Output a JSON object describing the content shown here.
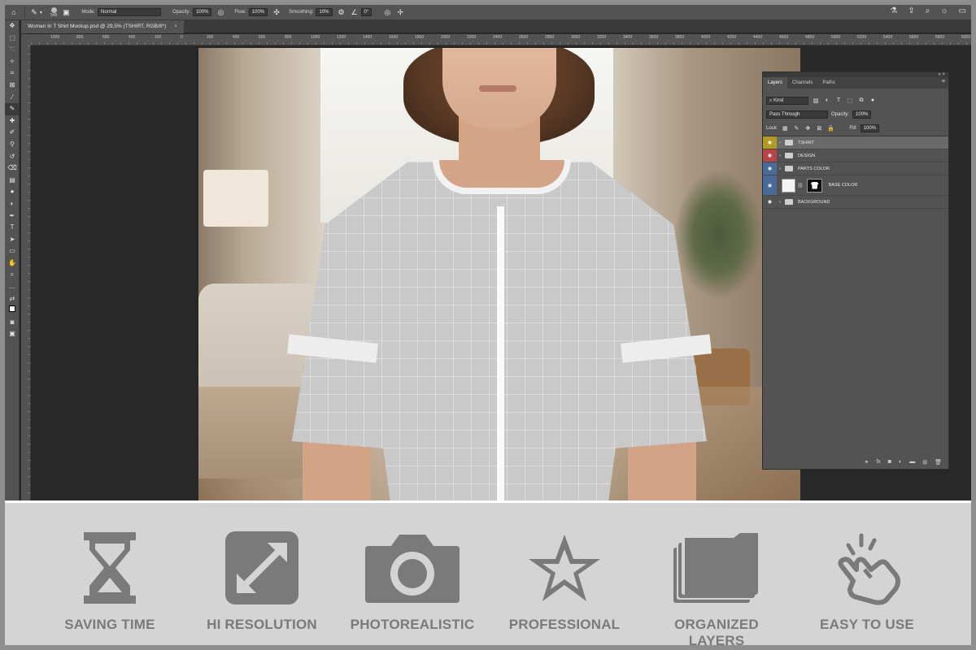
{
  "options_bar": {
    "brush_size": "545",
    "mode_label": "Mode:",
    "mode_value": "Normal",
    "opacity_label": "Opacity:",
    "opacity_value": "100%",
    "flow_label": "Flow:",
    "flow_value": "100%",
    "smoothing_label": "Smoothing:",
    "smoothing_value": "10%",
    "angle_value": "0°"
  },
  "document": {
    "tab_title": "Woman In T Shirt Mockup.psd @ 29,5% (TSHIRT, RGB/8*)",
    "close_glyph": "×"
  },
  "ruler": {
    "ticks": [
      "1000",
      "800",
      "600",
      "400",
      "200",
      "0",
      "200",
      "400",
      "600",
      "800",
      "1000",
      "1200",
      "1400",
      "1600",
      "1800",
      "2000",
      "2200",
      "2400",
      "2600",
      "2800",
      "3000",
      "3200",
      "3400",
      "3600",
      "3800",
      "4000",
      "4200",
      "4400",
      "4600",
      "4800",
      "5000",
      "5200",
      "5400",
      "5600",
      "5800",
      "6000"
    ]
  },
  "layers_panel": {
    "tabs": [
      "Layers",
      "Channels",
      "Paths"
    ],
    "filter_value": "Kind",
    "blend_mode": "Pass Through",
    "opacity_label": "Opacity:",
    "opacity_value": "100%",
    "lock_label": "Lock:",
    "fill_label": "Fill:",
    "fill_value": "100%",
    "layers": [
      {
        "name": "TSHIRT",
        "color": "#b09a24",
        "type": "group",
        "selected": true
      },
      {
        "name": "DESIGN",
        "color": "#b6454a",
        "type": "group",
        "selected": false
      },
      {
        "name": "PARTS COLOR",
        "color": "#4a6a98",
        "type": "group",
        "selected": false
      },
      {
        "name": "BASE COLOR",
        "color": "#4a6a98",
        "type": "smart",
        "selected": false
      },
      {
        "name": "BACKGROUND",
        "color": "#535353",
        "type": "group",
        "selected": false
      }
    ]
  },
  "features": [
    {
      "label": "SAVING TIME",
      "icon": "hourglass-icon"
    },
    {
      "label": "HI RESOLUTION",
      "icon": "expand-arrows-icon"
    },
    {
      "label": "PHOTOREALISTIC",
      "icon": "camera-icon"
    },
    {
      "label": "PROFESSIONAL",
      "icon": "star-icon"
    },
    {
      "label": "ORGANIZED LAYERS",
      "icon": "layers-folder-icon"
    },
    {
      "label": "EASY TO USE",
      "icon": "tap-hand-icon"
    }
  ],
  "colors": {
    "feature_icon": "#7a7a7a",
    "feature_band": "#d4d4d4",
    "app_bg": "#282828",
    "panel_bg": "#535353"
  }
}
